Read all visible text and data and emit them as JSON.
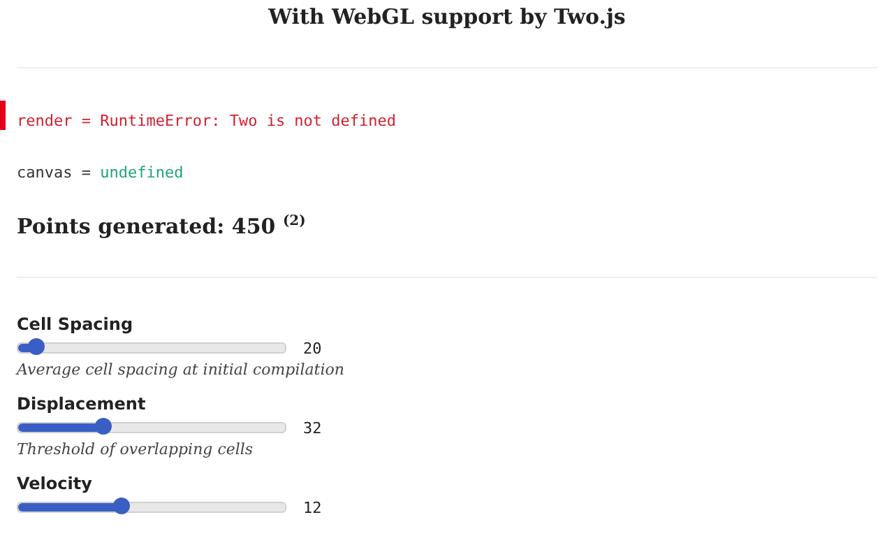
{
  "title": "With WebGL support by Two.js",
  "cells": [
    {
      "kind": "error",
      "name": "render",
      "operator": "=",
      "value": "RuntimeError: Two is not defined"
    },
    {
      "kind": "value",
      "name": "canvas",
      "operator": "=",
      "value": "undefined"
    }
  ],
  "points": {
    "text": "Points generated: 450",
    "note": "(2)"
  },
  "sliders": [
    {
      "label": "Cell Spacing",
      "level": 0.07,
      "reading": "20",
      "description": "Average cell spacing at initial compilation"
    },
    {
      "label": "Displacement",
      "level": 0.32,
      "reading": "32",
      "description": "Threshold of overlapping cells"
    },
    {
      "label": "Velocity",
      "level": 0.39,
      "reading": "12"
    }
  ]
}
